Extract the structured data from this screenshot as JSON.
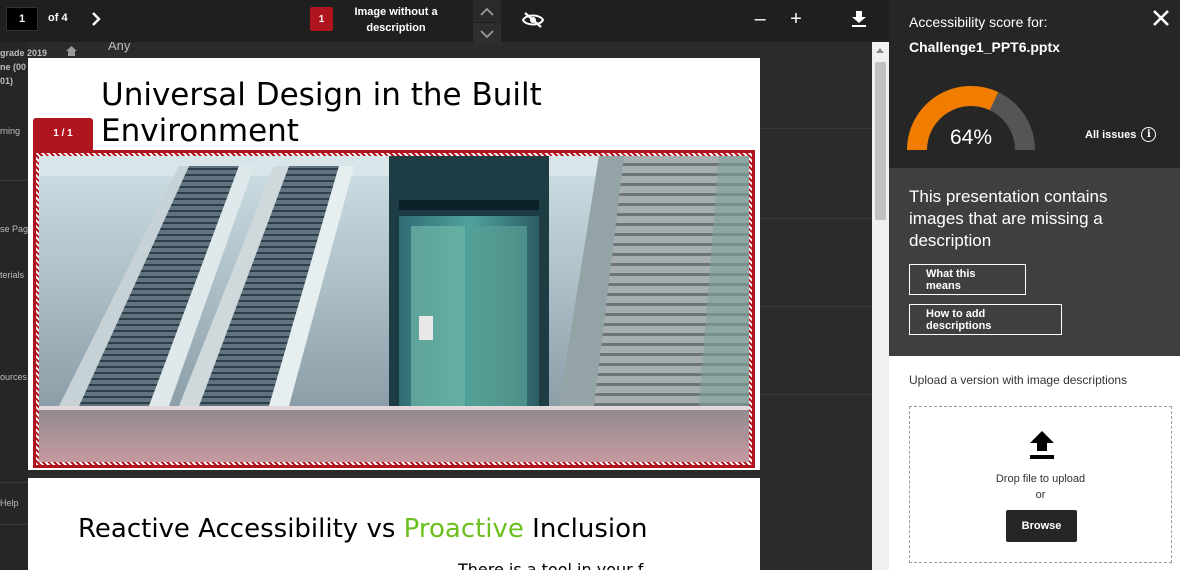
{
  "toolbar": {
    "current_page": "1",
    "page_of": "of 4",
    "issue_count": "1",
    "issue_label": "Image without a description",
    "zoom_out": "–",
    "zoom_in": "+"
  },
  "background_page": {
    "texts": [
      "Any",
      "grade 2019",
      "ne (00",
      "01)",
      "rning",
      "se Pag",
      "terials",
      "ources",
      "Help"
    ]
  },
  "slides": [
    {
      "title": "Universal Design in the Built Environment",
      "tag": "1 / 1"
    },
    {
      "title_part1": "Reactive Accessibility vs ",
      "title_part2": "Proactive",
      "title_part3": " Inclusion",
      "body": "There is a tool in your f"
    }
  ],
  "panel": {
    "score_label": "Accessibility score for:",
    "file_name": "Challenge1_PPT6.pptx",
    "score": "64%",
    "score_value": 0.64,
    "all_issues": "All issues",
    "message": "This presentation contains images that are missing a description",
    "what_means": "What this means",
    "how_to_add": "How to add descriptions",
    "upload_label": "Upload a version with image descriptions",
    "drop_text": "Drop file to upload",
    "or_text": "or",
    "browse": "Browse"
  },
  "colors": {
    "gauge_fill": "#f07c00",
    "gauge_track": "#555555",
    "issue_red": "#b0141f",
    "accent_green": "#6bbf1e"
  }
}
